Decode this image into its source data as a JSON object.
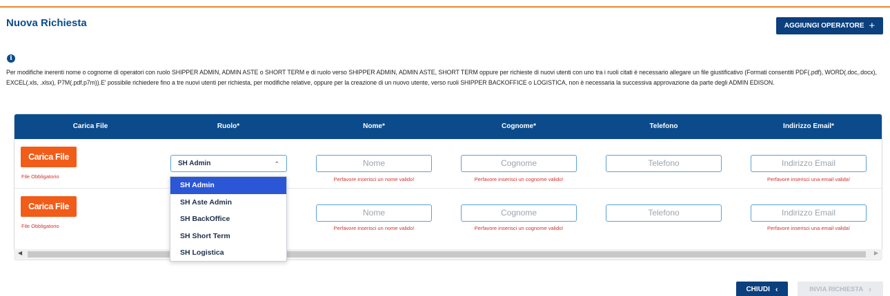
{
  "header": {
    "title": "Nuova Richiesta",
    "add_operator_label": "AGGIUNGI OPERATORE",
    "add_operator_icon": "plus-icon"
  },
  "info": {
    "icon": "info-icon",
    "text": "Per modifiche inerenti nome o cognome di operatori con ruolo SHIPPER ADMIN, ADMIN ASTE o SHORT TERM e di ruolo verso SHIPPER ADMIN, ADMIN ASTE, SHORT TERM oppure per richieste di nuovi utenti con uno tra i ruoli citati è necessario allegare un file giustificativo (Formati consentiti PDF(.pdf), WORD(.doc,.docx), EXCEL(.xls, .xlsx), P7M(.pdf.p7m)).E' possibile richiedere fino a tre nuovi utenti per richiesta, per modifiche relative, oppure per la creazione di un nuovo utente, verso ruoli SHIPPER BACKOFFICE o LOGISTICA, non è necessaria la successiva approvazione da parte degli ADMIN EDISON."
  },
  "table": {
    "columns": [
      "Carica File",
      "Ruolo*",
      "Nome*",
      "Cognome*",
      "Telefono",
      "Indirizzo Email*"
    ],
    "rows": [
      {
        "upload_label": "Carica File",
        "upload_required": "File Obbligatorio",
        "role_value": "SH Admin",
        "nome_placeholder": "Nome",
        "nome_error": "Perfavore inserisci un nome valido!",
        "cognome_placeholder": "Cognome",
        "cognome_error": "Perfavore inserisci un cognome valido!",
        "telefono_placeholder": "Telefono",
        "email_placeholder": "Indirizzo Email",
        "email_error": "Perfavore inserisci una email valida!"
      },
      {
        "upload_label": "Carica File",
        "upload_required": "File Obbligatorio",
        "nome_placeholder": "Nome",
        "nome_error": "Perfavore inserisci un nome valido!",
        "cognome_placeholder": "Cognome",
        "cognome_error": "Perfavore inserisci un cognome valido!",
        "telefono_placeholder": "Telefono",
        "email_placeholder": "Indirizzo Email",
        "email_error": "Perfavore inserisci una email valida!"
      }
    ]
  },
  "role_dropdown": {
    "options": [
      "SH Admin",
      "SH Aste Admin",
      "SH BackOffice",
      "SH Short Term",
      "SH Logistica"
    ],
    "selected": "SH Admin"
  },
  "footer": {
    "close_label": "CHIUDI",
    "submit_label": "INVIA RICHIESTA"
  },
  "colors": {
    "primary": "#0b4b8c",
    "accent_orange": "#f25c19",
    "error": "#d0312d",
    "selected_option": "#2b56d6"
  }
}
